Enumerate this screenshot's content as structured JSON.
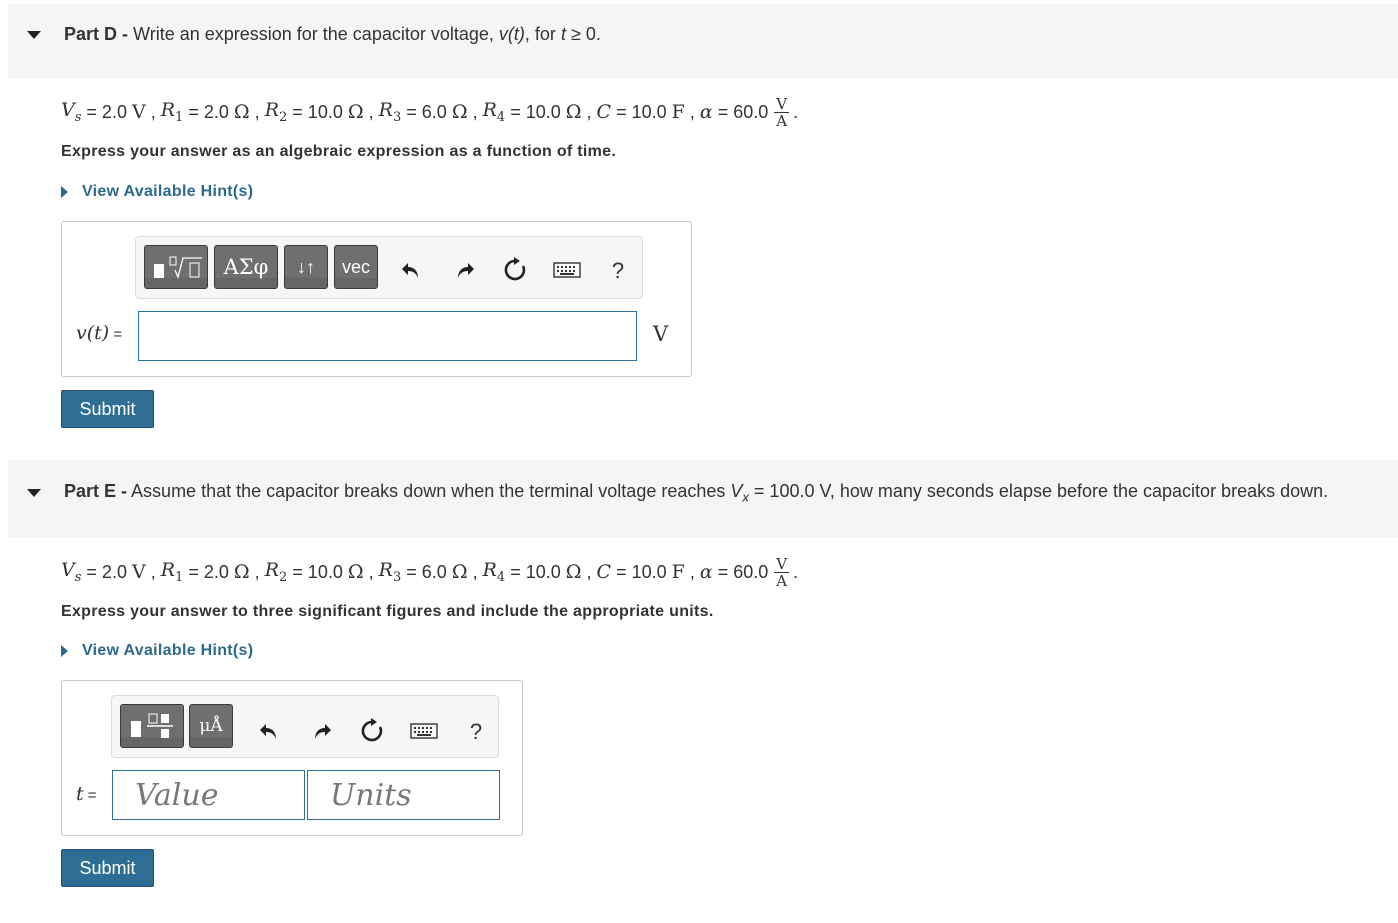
{
  "partD": {
    "label": "Part D -",
    "text_pre": "Write an expression for the capacitor voltage,",
    "var": "v(t)",
    "text_mid": ", for",
    "tvar": "t",
    "text_post": "≥ 0.",
    "instruction": "Express your answer as an algebraic expression as a function of time.",
    "hint_label": "View Available Hint(s)",
    "answer_label_var": "v(t)",
    "answer_label_eq": " =",
    "answer_unit": "V",
    "input_value": "",
    "submit_label": "Submit",
    "toolbar": {
      "templates_label": "",
      "greek_label": "ΑΣφ",
      "arrows_label": "↓↑",
      "vec_label": "vec",
      "help_label": "?"
    }
  },
  "partE": {
    "label": "Part E -",
    "text_pre": "Assume that the capacitor breaks down when the terminal voltage reaches",
    "vsym": "V",
    "vsub": "x",
    "text_post": "= 100.0 V, how many seconds elapse before the capacitor breaks down.",
    "instruction": "Express your answer to three significant figures and include the appropriate units.",
    "hint_label": "View Available Hint(s)",
    "answer_label_var": "t",
    "answer_label_eq": " =",
    "value_placeholder": "Value",
    "units_placeholder": "Units",
    "submit_label": "Submit",
    "toolbar": {
      "units_label": "μÅ",
      "help_label": "?"
    }
  },
  "givens": {
    "Vs_val": "= 2.0",
    "Vs_unit": "V",
    "R1_val": "= 2.0",
    "R2_val": "= 10.0",
    "R3_val": "= 6.0",
    "R4_val": "= 10.0",
    "C_val": "= 10.0",
    "C_unit": "F",
    "alpha_val": "= 60.0",
    "ohm": "Ω",
    "frac_num": "V",
    "frac_den": "A"
  },
  "colors": {
    "accent": "#2e6e94",
    "link": "#2b6a8e",
    "header_bg": "#f5f5f5"
  }
}
